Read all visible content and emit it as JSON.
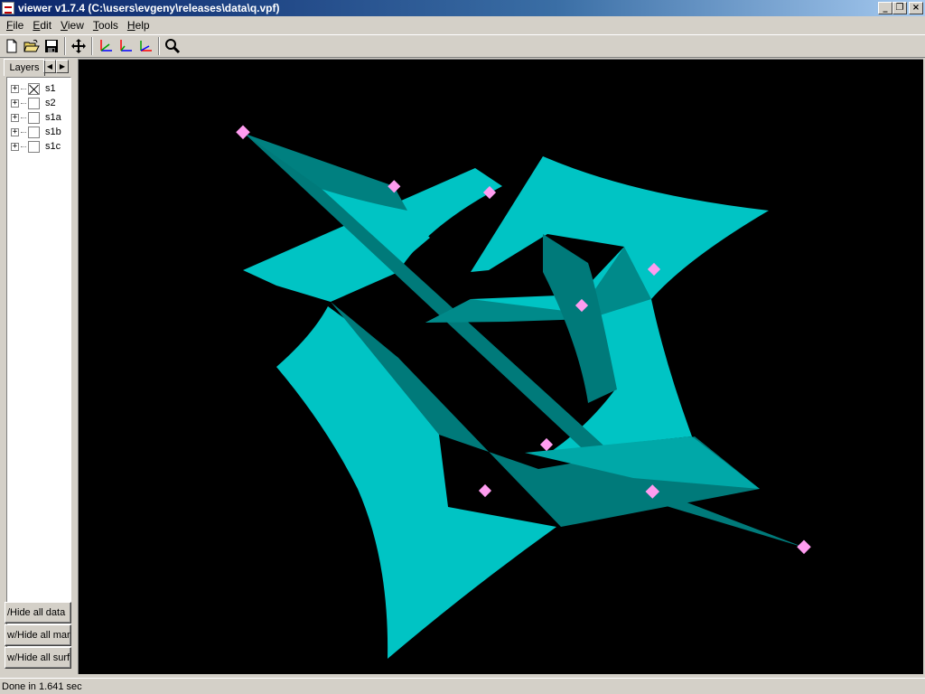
{
  "window": {
    "title": "viewer v1.7.4 (C:\\users\\evgeny\\releases\\data\\q.vpf)",
    "controls": {
      "minimize": "_",
      "restore": "❐",
      "close": "×"
    }
  },
  "menu": [
    {
      "label": "File",
      "accel": "F",
      "rest": "ile"
    },
    {
      "label": "Edit",
      "accel": "E",
      "rest": "dit"
    },
    {
      "label": "View",
      "accel": "V",
      "rest": "iew"
    },
    {
      "label": "Tools",
      "accel": "T",
      "rest": "ools"
    },
    {
      "label": "Help",
      "accel": "H",
      "rest": "elp"
    }
  ],
  "toolbar": {
    "icons": [
      "new-file-icon",
      "open-folder-icon",
      "save-icon",
      "move-icon",
      "axis-x-icon",
      "axis-y-icon",
      "axis-z-icon",
      "zoom-icon"
    ],
    "colors": {
      "axis_red": "#ff0000",
      "axis_green": "#00a000",
      "axis_blue": "#0000ff"
    }
  },
  "layers_panel": {
    "tab_label": "Layers",
    "prev_arrow": "◀",
    "next_arrow": "▶",
    "items": [
      {
        "label": "s1",
        "checked": true,
        "expander": "+"
      },
      {
        "label": "s2",
        "checked": false,
        "expander": "+"
      },
      {
        "label": "s1a",
        "checked": false,
        "expander": "+"
      },
      {
        "label": "s1b",
        "checked": false,
        "expander": "+"
      },
      {
        "label": "s1c",
        "checked": false,
        "expander": "+"
      }
    ],
    "buttons": [
      {
        "label": "/Hide all data"
      },
      {
        "label": "w/Hide all mar"
      },
      {
        "label": "w/Hide all surf"
      }
    ]
  },
  "scene": {
    "background": "#000000",
    "surface_color_light": "#00c4c4",
    "surface_color_dark": "#007a7a",
    "marker_color": "#ff9cf0"
  },
  "status": {
    "text": "Done in 1.641 sec"
  }
}
